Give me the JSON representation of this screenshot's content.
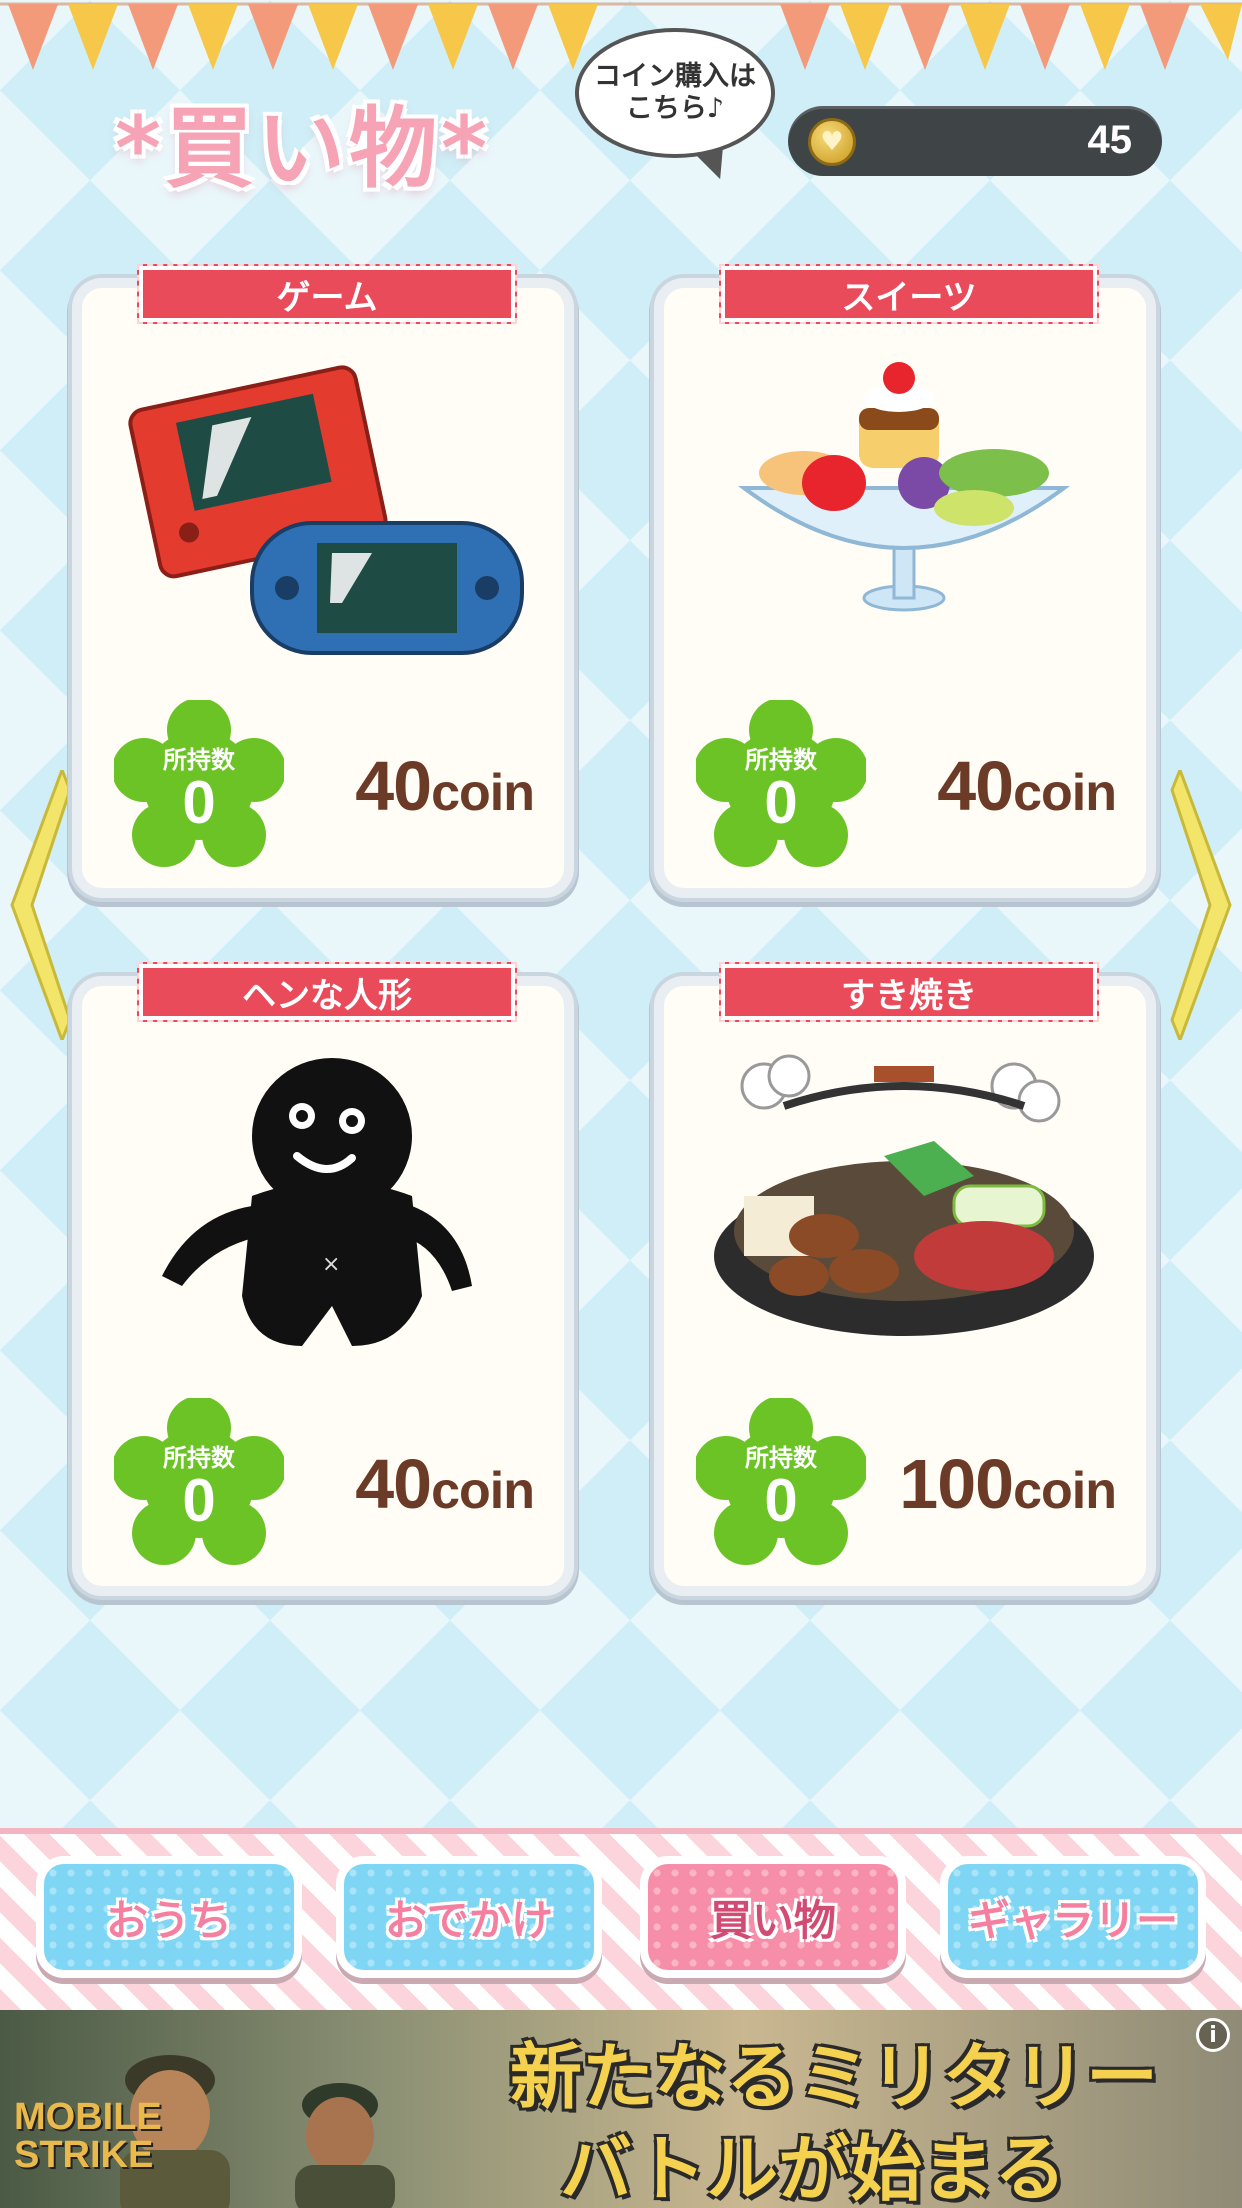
{
  "header": {
    "title": "*買い物*",
    "buy_coins_bubble": "コイン購入は\nこちら♪",
    "coin_balance": "45"
  },
  "items": [
    {
      "name": "ゲーム",
      "owned_label": "所持数",
      "owned": "0",
      "price": "40",
      "unit": "coin",
      "icon": "game-console-icon"
    },
    {
      "name": "スイーツ",
      "owned_label": "所持数",
      "owned": "0",
      "price": "40",
      "unit": "coin",
      "icon": "sundae-icon"
    },
    {
      "name": "ヘンな人形",
      "owned_label": "所持数",
      "owned": "0",
      "price": "40",
      "unit": "coin",
      "icon": "doll-icon"
    },
    {
      "name": "すき焼き",
      "owned_label": "所持数",
      "owned": "0",
      "price": "100",
      "unit": "coin",
      "icon": "sukiyaki-icon"
    }
  ],
  "nav": [
    {
      "label": "おうち"
    },
    {
      "label": "おでかけ"
    },
    {
      "label": "買い物",
      "active": true
    },
    {
      "label": "ギャラリー"
    }
  ],
  "ad": {
    "logo": "MOBILE\nSTRIKE",
    "line1": "新たなるミリタリー",
    "line2": "バトルが始まる",
    "info": "i"
  },
  "colors": {
    "ribbon": "#ea4b5b",
    "price": "#6b3b27",
    "badge": "#6cc326",
    "nav_active": "#f78ea9",
    "nav_default": "#7ed6f4"
  }
}
